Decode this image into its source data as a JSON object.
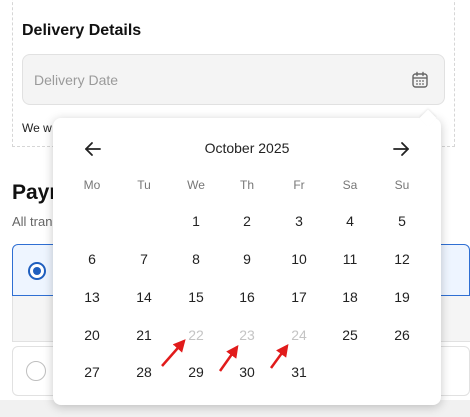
{
  "delivery": {
    "title": "Delivery Details",
    "date_placeholder": "Delivery Date",
    "note_prefix": "We w"
  },
  "payment": {
    "title_partial": "Payn",
    "subtitle_partial": "All tran"
  },
  "calendar": {
    "month_label": "October 2025",
    "weekdays": [
      "Mo",
      "Tu",
      "We",
      "Th",
      "Fr",
      "Sa",
      "Su"
    ],
    "weeks": [
      [
        "",
        "",
        "1",
        "2",
        "3",
        "4",
        "5"
      ],
      [
        "6",
        "7",
        "8",
        "9",
        "10",
        "11",
        "12"
      ],
      [
        "13",
        "14",
        "15",
        "16",
        "17",
        "18",
        "19"
      ],
      [
        "20",
        "21",
        "22",
        "23",
        "24",
        "25",
        "26"
      ],
      [
        "27",
        "28",
        "29",
        "30",
        "31",
        "",
        ""
      ]
    ],
    "disabled_days": [
      "22",
      "23",
      "24"
    ]
  },
  "colors": {
    "accent": "#1f5fbf",
    "annotation_arrow": "#e11b1b"
  },
  "icons": {
    "date_field": "calendar-icon",
    "prev": "arrow-left-icon",
    "next": "arrow-right-icon"
  }
}
